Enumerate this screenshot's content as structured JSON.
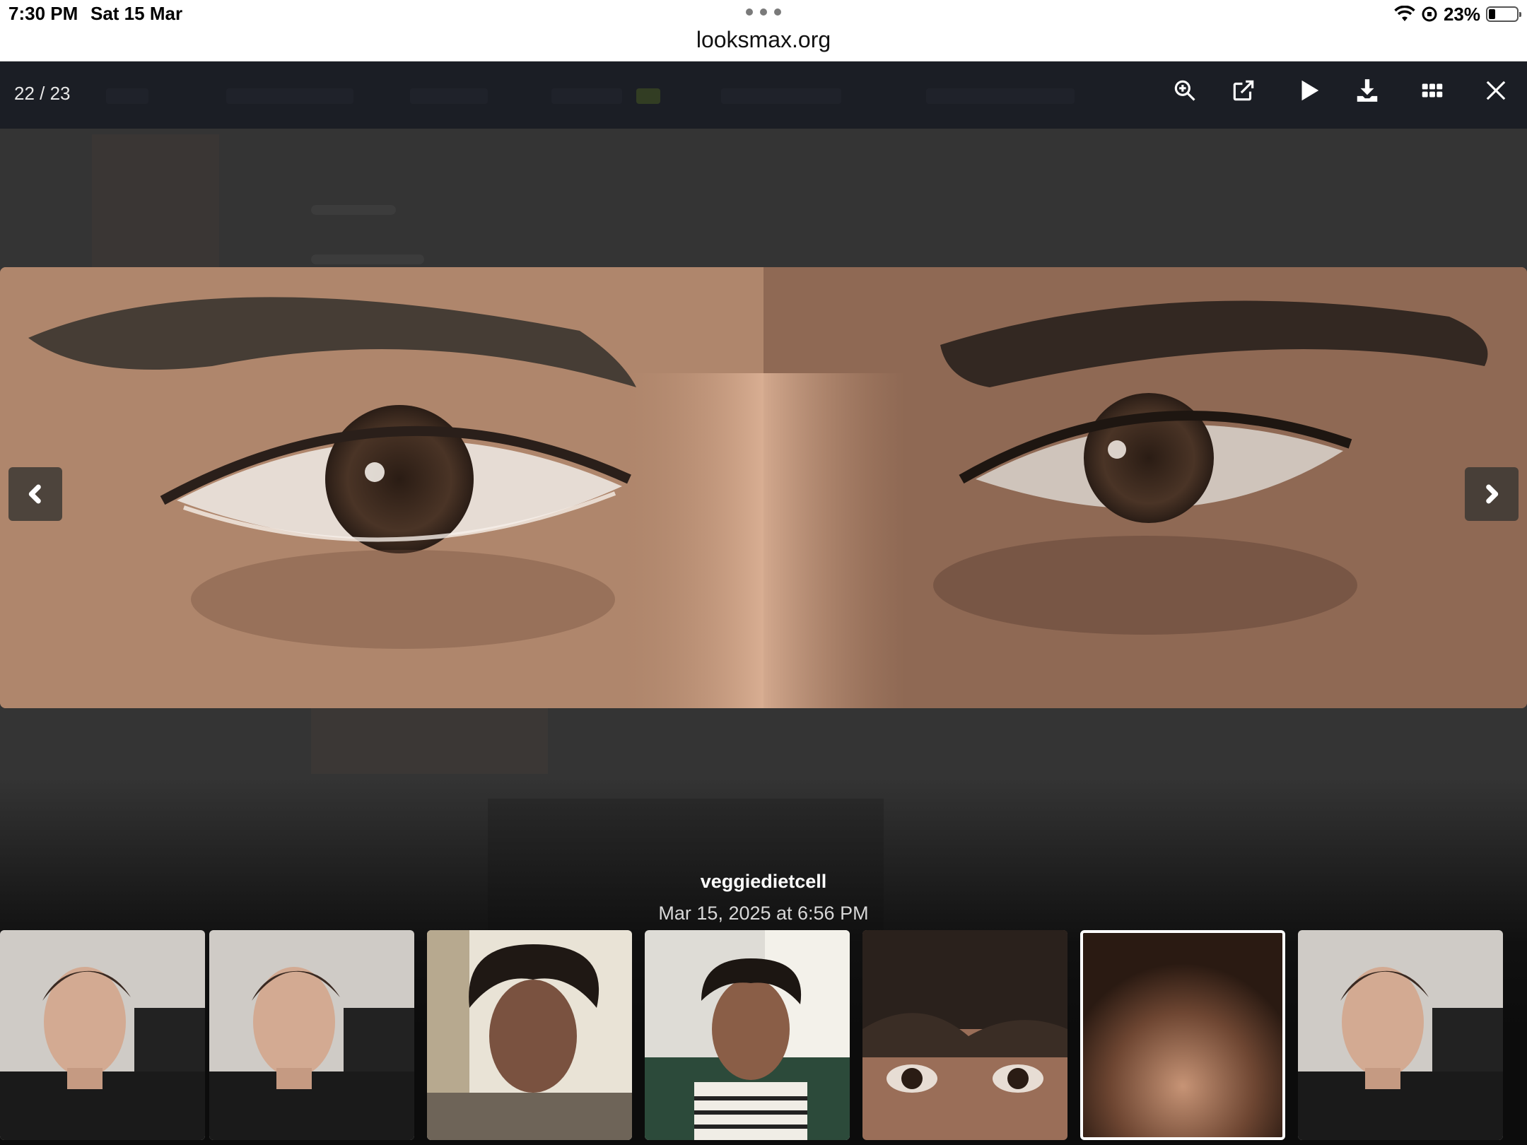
{
  "status_bar": {
    "time": "7:30 PM",
    "date": "Sat 15 Mar",
    "battery_percent": "23%",
    "battery_level": 0.23
  },
  "browser": {
    "url": "looksmax.org"
  },
  "lightbox": {
    "counter": "22 / 23",
    "toolbar_icons": [
      "zoom-in-icon",
      "open-external-icon",
      "play-icon",
      "download-icon",
      "grid-icon",
      "close-icon"
    ],
    "caption": {
      "title": "veggiedietcell",
      "date": "Mar 15, 2025 at 6:56 PM"
    },
    "thumbnails": [
      {
        "icon": "portrait-man-photo"
      },
      {
        "icon": "portrait-man-photo"
      },
      {
        "icon": "portrait-curly-hair-photo"
      },
      {
        "icon": "portrait-striped-shirt-photo"
      },
      {
        "icon": "eyes-closeup-photo"
      },
      {
        "icon": "nose-closeup-photo",
        "active": true
      },
      {
        "icon": "portrait-man-photo"
      }
    ]
  },
  "colors": {
    "accent": "#ffffff",
    "toolbar_bg": "#16181e",
    "backdrop": "#303030"
  }
}
